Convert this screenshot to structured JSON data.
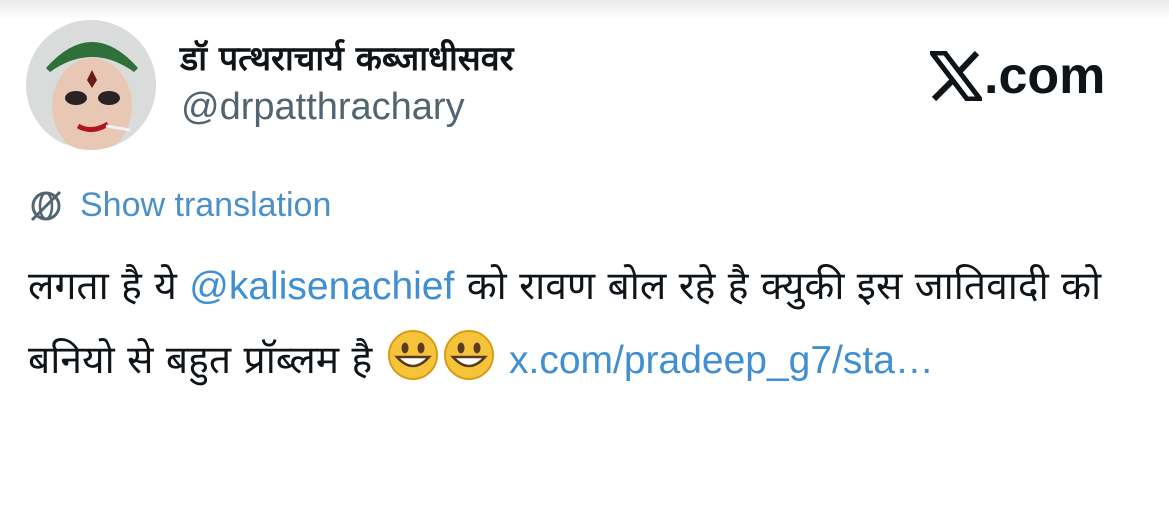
{
  "author": {
    "display_name": "डॉ पत्थराचार्य कब्जाधीसवर",
    "handle": "@drpatthrachary",
    "avatar": "profile-photo"
  },
  "brand": {
    "text": ".com",
    "logo": "x-logo"
  },
  "translate": {
    "label": "Show translation",
    "icon": "globe-icon"
  },
  "tweet": {
    "text_before_mention": "लगता है ये ",
    "mention": "@kalisenachief",
    "text_after_mention": " को रावण बोल रहे है क्युकी इस जातिवादी को बनियो से बहुत प्रॉब्लम है ",
    "emojis": [
      "grinning-face",
      "grinning-face"
    ],
    "link": "x.com/pradeep_g7/sta…"
  },
  "colors": {
    "link": "#3f8fd2",
    "text": "#0f1419",
    "muted": "#536471"
  }
}
